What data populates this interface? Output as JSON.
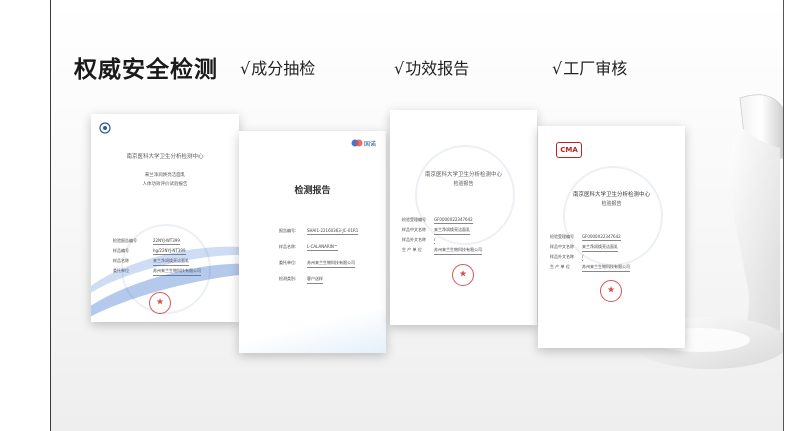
{
  "heading": "权威安全检测",
  "checks": [
    {
      "tick": "√",
      "label": "成分抽检"
    },
    {
      "tick": "√",
      "label": "功效报告"
    },
    {
      "tick": "√",
      "label": "工厂审核"
    }
  ],
  "doc1": {
    "org": "南京医科大学卫生分析检测中心",
    "sub1": "来兰净润焕亮洁面乳",
    "sub2": "人体功效评价试验报告",
    "rows": [
      {
        "k": "检验报告编号",
        "v": "22NYJ-WT399"
      },
      {
        "k": "样品编号",
        "v": "hg/22NYJ-NT399"
      },
      {
        "k": "样品名称",
        "v": "来兰净润焕亮洁面乳"
      },
      {
        "k": "委托单位",
        "v": "苏州来兰生物科技有限公司"
      }
    ]
  },
  "doc2": {
    "brand": "国诺",
    "title": "检测报告",
    "rows": [
      {
        "k": "报告编号:",
        "v": "SHAI1-22160363-JC-01R1"
      },
      {
        "k": "样品名称:",
        "v": "L-CALANARIN™"
      },
      {
        "k": "委托单位:",
        "v": "苏州来兰生物科技有限公司"
      },
      {
        "k": "检测类别:",
        "v": "客户送样"
      }
    ]
  },
  "doc3": {
    "org": "南京医科大学卫生分析检测中心",
    "sub": "检验报告",
    "rows": [
      {
        "k": "检验受理编号",
        "v": "GF0000X22347642"
      },
      {
        "k": "样品中文名称",
        "v": "来兰净润焕亮洁面乳"
      },
      {
        "k": "样品外文名称",
        "v": "/"
      },
      {
        "k": "生 产 单 位",
        "v": "苏州来兰生物科技有限公司"
      }
    ]
  },
  "doc4": {
    "logo": "CMA",
    "org": "南京医科大学卫生分析检测中心",
    "sub": "检验报告",
    "rows": [
      {
        "k": "检验受理编号",
        "v": "GF0000X22347642"
      },
      {
        "k": "样品中文名称",
        "v": "来兰净润焕亮洁面乳"
      },
      {
        "k": "样品外文名称",
        "v": "/"
      },
      {
        "k": "生 产 单 位",
        "v": "苏州来兰生物科技有限公司"
      }
    ]
  },
  "colors": {
    "accent_red": "#c81e1e",
    "brand_blue": "#3c78d2",
    "text": "#1a1a1a"
  }
}
